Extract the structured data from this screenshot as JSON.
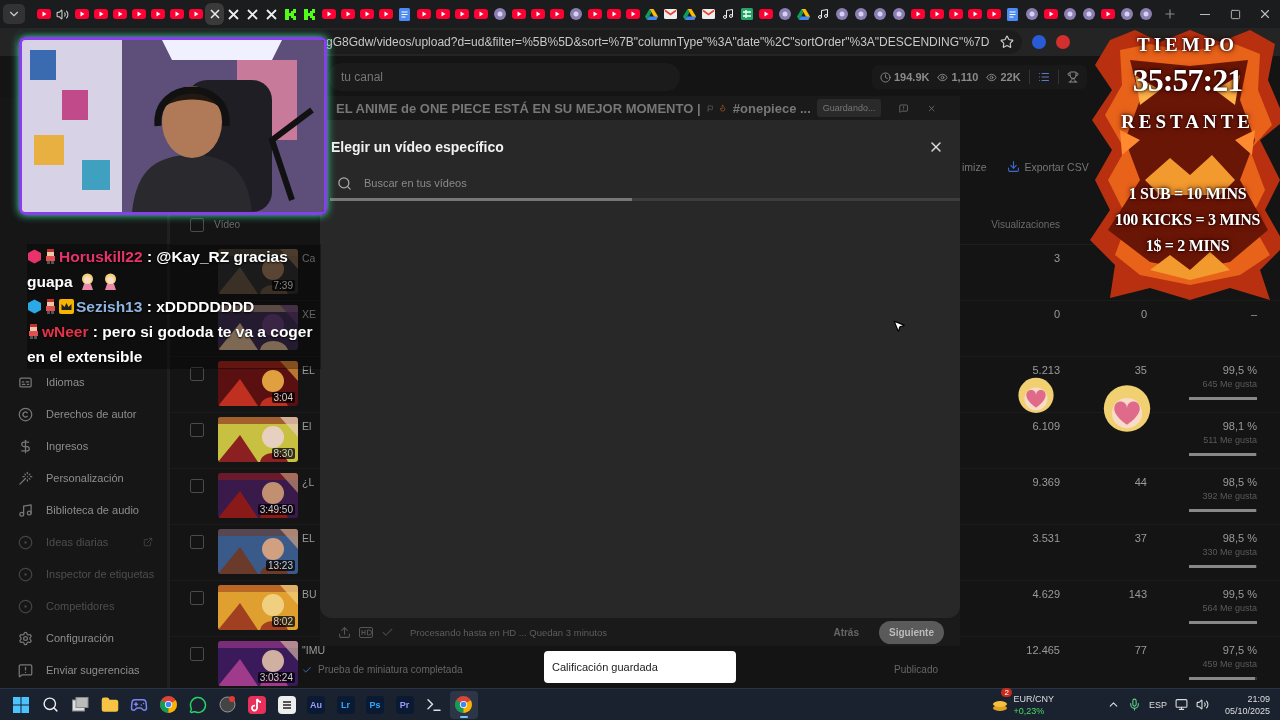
{
  "browser": {
    "tabs": [
      {
        "kind": "youtube",
        "selected": false
      },
      {
        "kind": "audio",
        "selected": false
      },
      {
        "kind": "youtube",
        "selected": false
      },
      {
        "kind": "youtube",
        "selected": false
      },
      {
        "kind": "youtube",
        "selected": false
      },
      {
        "kind": "youtube",
        "selected": false
      },
      {
        "kind": "youtube",
        "selected": false
      },
      {
        "kind": "youtube",
        "selected": false
      },
      {
        "kind": "youtube",
        "selected": false
      },
      {
        "selected": true
      },
      {
        "kind": "x",
        "selected": false
      },
      {
        "kind": "x",
        "selected": false
      },
      {
        "kind": "x",
        "selected": false
      },
      {
        "kind": "kick",
        "selected": false
      },
      {
        "kind": "kick",
        "selected": false
      },
      {
        "kind": "youtube",
        "selected": false
      },
      {
        "kind": "youtube",
        "selected": false
      },
      {
        "kind": "youtube",
        "selected": false
      },
      {
        "kind": "youtube",
        "selected": false
      },
      {
        "kind": "doc",
        "selected": false
      },
      {
        "kind": "youtube",
        "selected": false
      },
      {
        "kind": "youtube",
        "selected": false
      },
      {
        "kind": "youtube",
        "selected": false
      },
      {
        "kind": "youtube",
        "selected": false
      },
      {
        "kind": "generic",
        "selected": false
      },
      {
        "kind": "youtube",
        "selected": false
      },
      {
        "kind": "youtube",
        "selected": false
      },
      {
        "kind": "youtube",
        "selected": false
      },
      {
        "kind": "generic",
        "selected": false
      },
      {
        "kind": "youtube",
        "selected": false
      },
      {
        "kind": "youtube",
        "selected": false
      },
      {
        "kind": "youtube",
        "selected": false
      },
      {
        "kind": "drive",
        "selected": false
      },
      {
        "kind": "gmail",
        "selected": false
      },
      {
        "kind": "drive",
        "selected": false
      },
      {
        "kind": "gmail",
        "selected": false
      },
      {
        "kind": "tiktok",
        "selected": false
      },
      {
        "kind": "sheet",
        "selected": false
      },
      {
        "kind": "youtube",
        "selected": false
      },
      {
        "kind": "generic",
        "selected": false
      },
      {
        "kind": "drive",
        "selected": false
      },
      {
        "kind": "tiktok",
        "selected": false
      },
      {
        "kind": "generic",
        "selected": false
      },
      {
        "kind": "generic",
        "selected": false
      },
      {
        "kind": "generic",
        "selected": false
      },
      {
        "kind": "generic",
        "selected": false
      },
      {
        "kind": "youtube",
        "selected": false
      },
      {
        "kind": "youtube",
        "selected": false
      },
      {
        "kind": "youtube",
        "selected": false
      },
      {
        "kind": "youtube",
        "selected": false
      },
      {
        "kind": "youtube",
        "selected": false
      },
      {
        "kind": "doc",
        "selected": false
      },
      {
        "kind": "generic",
        "selected": false
      },
      {
        "kind": "youtube",
        "selected": false
      },
      {
        "kind": "generic",
        "selected": false
      },
      {
        "kind": "generic",
        "selected": false
      },
      {
        "kind": "youtube",
        "selected": false
      },
      {
        "kind": "generic",
        "selected": false
      },
      {
        "kind": "generic",
        "selected": false
      }
    ],
    "address": {
      "url": "gG8Gdw/videos/upload?d=ud&filter=%5B%5D&sort=%7B\"columnType\"%3A\"date\"%2C\"sortOrder\"%3A\"DESCENDING\"%7D"
    }
  },
  "studio": {
    "header": {
      "search_placeholder": "tu canal",
      "stats": [
        {
          "kind": "clock",
          "value": "194.9K"
        },
        {
          "kind": "eye",
          "value": "1,110"
        },
        {
          "kind": "eye",
          "value": "22K"
        }
      ]
    },
    "sidebar": {
      "items": [
        {
          "kind": "captions",
          "label": "Idiomas",
          "disabled": false
        },
        {
          "kind": "copyright",
          "label": "Derechos de autor",
          "disabled": false
        },
        {
          "kind": "money",
          "label": "Ingresos",
          "disabled": false
        },
        {
          "kind": "wand",
          "label": "Personalización",
          "disabled": false
        },
        {
          "kind": "music",
          "label": "Biblioteca de audio",
          "disabled": false
        },
        {
          "kind": "plugin",
          "label": "Ideas diarias",
          "disabled": true,
          "external": true
        },
        {
          "kind": "plugin",
          "label": "Inspector de etiquetas",
          "disabled": true
        },
        {
          "kind": "plugin",
          "label": "Competidores",
          "disabled": true
        },
        {
          "kind": "settings",
          "label": "Configuración",
          "disabled": false
        },
        {
          "kind": "feedback",
          "label": "Enviar sugerencias",
          "disabled": false
        }
      ]
    },
    "toolbar": {
      "optimize_fragment": "imize",
      "export_label": "Exportar CSV"
    },
    "table": {
      "columns": [
        "Vídeo",
        "Visualizaciones"
      ],
      "all_checked": false,
      "rows": [
        {
          "title": "Ca",
          "duration": "7:39",
          "views": "3"
        },
        {
          "title": "XE",
          "views": "0",
          "comments": "0",
          "likes": "–"
        },
        {
          "checked": false,
          "title": "EL",
          "duration": "3:04",
          "views": "5.213",
          "comments": "35",
          "likes": "99,5 %",
          "likes_count": "645 Me gusta",
          "level": 0.995
        },
        {
          "checked": false,
          "title": "El",
          "duration": "8:30",
          "views": "6.109",
          "likes": "98,1 %",
          "likes_count": "511 Me gusta",
          "level": 0.981
        },
        {
          "checked": false,
          "title": "¿L",
          "duration": "3:49:50",
          "views": "9.369",
          "comments": "44",
          "likes": "98,5 %",
          "likes_count": "392 Me gusta",
          "level": 0.985
        },
        {
          "checked": false,
          "title": "EL",
          "duration": "13:23",
          "views": "3.531",
          "comments": "37",
          "likes": "98,5 %",
          "likes_count": "330 Me gusta",
          "level": 0.985
        },
        {
          "checked": false,
          "title": "BU",
          "duration": "8:02",
          "views": "4.629",
          "comments": "143",
          "likes": "99,5 %",
          "likes_count": "564 Me gusta",
          "level": 0.995
        },
        {
          "checked": false,
          "title": "\"IMU",
          "duration": "3:03:24",
          "views": "12.465",
          "comments": "77",
          "likes": "97,5 %",
          "likes_count": "459 Me gusta",
          "level": 0.975,
          "note": "Prueba de miniatura completada",
          "status": "Publicado"
        }
      ]
    }
  },
  "upload_dialog": {
    "title": "EL ANIME de ONE PIECE ESTÁ EN SU MEJOR MOMENTO |",
    "hashtag": "#onepiece ...",
    "status": "Guardando...",
    "footer": {
      "status": "Procesando hasta en HD ... Quedan 3 minutos",
      "buttons": [
        {
          "kind": "text",
          "label": "Atrás"
        },
        {
          "kind": "filled",
          "label": "Siguiente"
        }
      ]
    }
  },
  "picker_modal": {
    "title": "Elegir un vídeo específico",
    "search": {
      "placeholder": "Buscar en tus vídeos"
    },
    "loading": {
      "level": 0.48
    }
  },
  "toast": {
    "text": "Calificación guardada"
  },
  "stream_overlay": {
    "chat": [
      {
        "user": "Horuskill22",
        "color": "#e8336a",
        "badges": [
          {
            "kind": "cube",
            "color": "#e8336a"
          },
          {
            "kind": "sprite"
          }
        ],
        "lines": [
          ": @Kay_RZ gracias",
          "guapa"
        ],
        "emotes": [
          {
            "kind": "chibi"
          },
          {
            "kind": "chibi"
          }
        ]
      },
      {
        "user": "Sezish13",
        "color": "#8fb4e0",
        "badges": [
          {
            "kind": "cube",
            "color": "#2aa8e8"
          },
          {
            "kind": "sprite"
          },
          {
            "kind": "crown"
          }
        ],
        "lines": [
          ": xDDDDDDDD"
        ]
      },
      {
        "user": "wNeer",
        "color": "#e8324a",
        "badges": [
          {
            "kind": "sprite"
          }
        ],
        "lines": [
          ": pero si gododa te va a coger",
          "en el extensible"
        ]
      }
    ],
    "timer": {
      "label_top": "TIEMPO",
      "time": "35:57:21",
      "label_bottom": "RESTANTE",
      "rules": [
        "1 SUB = 10 MINS",
        "100 KICKS = 3 MINS",
        "1$ = 2 MINS"
      ]
    }
  },
  "taskbar": {
    "apps": [
      {
        "kind": "windows",
        "selected": false
      },
      {
        "kind": "search",
        "selected": false
      },
      {
        "kind": "taskview",
        "selected": false
      },
      {
        "kind": "folder",
        "selected": false
      },
      {
        "kind": "discord",
        "selected": false
      },
      {
        "kind": "chrome",
        "selected": false
      },
      {
        "kind": "whatsapp",
        "selected": false
      },
      {
        "kind": "steam",
        "selected": false
      },
      {
        "kind": "tiktok",
        "selected": false
      },
      {
        "kind": "app",
        "selected": false
      },
      {
        "kind": "label",
        "label": "Au",
        "color": "#9999ff",
        "selected": false
      },
      {
        "kind": "label",
        "label": "Lr",
        "color": "#31a8ff",
        "selected": false
      },
      {
        "kind": "label",
        "label": "Ps",
        "color": "#31a8ff",
        "selected": false
      },
      {
        "kind": "label",
        "label": "Pr",
        "color": "#9999ff",
        "selected": false
      },
      {
        "kind": "terminal",
        "selected": false
      },
      {
        "kind": "chrome",
        "selected": true
      }
    ],
    "tray": {
      "widget_badge": "2",
      "widget_title": "EUR/CNY",
      "widget_change": "+0,23%",
      "language": "ESP",
      "time": "21:09",
      "date": "05/10/2025"
    }
  }
}
